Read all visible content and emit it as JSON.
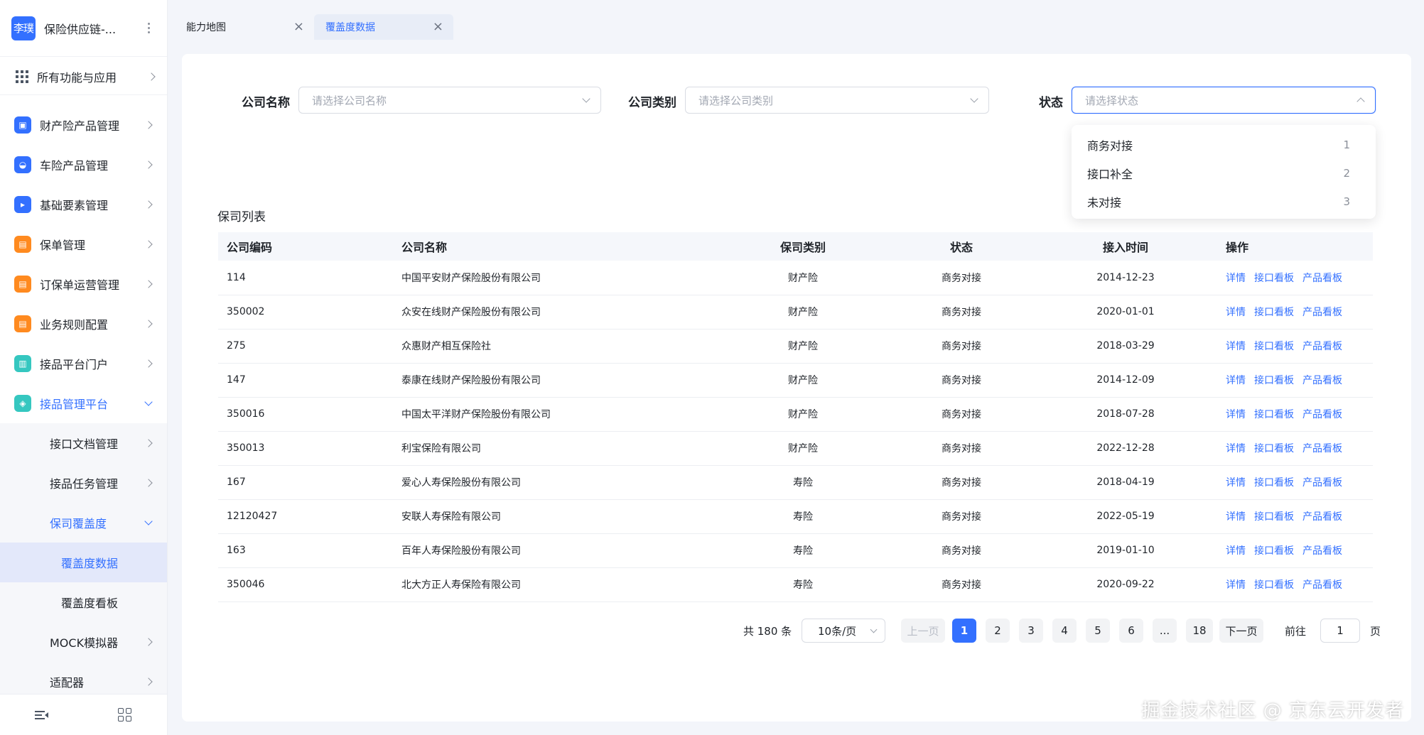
{
  "sidebar": {
    "avatar_text": "李璞",
    "app_title": "保险供应链-...",
    "all_apps_label": "所有功能与应用",
    "items": [
      {
        "label": "财产险产品管理",
        "icon": "briefcase-icon",
        "color": "#3370ff"
      },
      {
        "label": "车险产品管理",
        "icon": "car-icon",
        "color": "#3370ff"
      },
      {
        "label": "基础要素管理",
        "icon": "terminal-icon",
        "color": "#3370ff"
      },
      {
        "label": "保单管理",
        "icon": "document-icon",
        "color": "#ff8a1f"
      },
      {
        "label": "订保单运营管理",
        "icon": "document-icon",
        "color": "#ff8a1f"
      },
      {
        "label": "业务规则配置",
        "icon": "document-icon",
        "color": "#ff8a1f"
      },
      {
        "label": "接品平台门户",
        "icon": "notebook-icon",
        "color": "#35c7c0"
      },
      {
        "label": "接品管理平台",
        "icon": "cube-icon",
        "color": "#35c7c0"
      }
    ],
    "sub_items": [
      {
        "label": "接口文档管理"
      },
      {
        "label": "接品任务管理"
      },
      {
        "label": "保司覆盖度"
      },
      {
        "label": "覆盖度数据"
      },
      {
        "label": "覆盖度看板"
      },
      {
        "label": "MOCK模拟器"
      },
      {
        "label": "适配器"
      }
    ]
  },
  "tabs": [
    {
      "label": "能力地图",
      "close": "×"
    },
    {
      "label": "覆盖度数据",
      "close": "×"
    }
  ],
  "filters": {
    "company_name": {
      "label": "公司名称",
      "placeholder": "请选择公司名称"
    },
    "company_type": {
      "label": "公司类别",
      "placeholder": "请选择公司类别"
    },
    "status": {
      "label": "状态",
      "placeholder": "请选择状态"
    }
  },
  "status_options": [
    {
      "label": "商务对接",
      "value": "1"
    },
    {
      "label": "接口补全",
      "value": "2"
    },
    {
      "label": "未对接",
      "value": "3"
    }
  ],
  "list": {
    "title": "保司列表",
    "columns": [
      "公司编码",
      "公司名称",
      "保司类别",
      "状态",
      "接入时间",
      "操作"
    ],
    "actions": [
      "详情",
      "接口看板",
      "产品看板"
    ],
    "rows": [
      {
        "code": "114",
        "name": "中国平安财产保险股份有限公司",
        "type": "财产险",
        "status": "商务对接",
        "date": "2014-12-23"
      },
      {
        "code": "350002",
        "name": "众安在线财产保险股份有限公司",
        "type": "财产险",
        "status": "商务对接",
        "date": "2020-01-01"
      },
      {
        "code": "275",
        "name": "众惠财产相互保险社",
        "type": "财产险",
        "status": "商务对接",
        "date": "2018-03-29"
      },
      {
        "code": "147",
        "name": "泰康在线财产保险股份有限公司",
        "type": "财产险",
        "status": "商务对接",
        "date": "2014-12-09"
      },
      {
        "code": "350016",
        "name": "中国太平洋财产保险股份有限公司",
        "type": "财产险",
        "status": "商务对接",
        "date": "2018-07-28"
      },
      {
        "code": "350013",
        "name": "利宝保险有限公司",
        "type": "财产险",
        "status": "商务对接",
        "date": "2022-12-28"
      },
      {
        "code": "167",
        "name": "爱心人寿保险股份有限公司",
        "type": "寿险",
        "status": "商务对接",
        "date": "2018-04-19"
      },
      {
        "code": "12120427",
        "name": "安联人寿保险有限公司",
        "type": "寿险",
        "status": "商务对接",
        "date": "2022-05-19"
      },
      {
        "code": "163",
        "name": "百年人寿保险股份有限公司",
        "type": "寿险",
        "status": "商务对接",
        "date": "2019-01-10"
      },
      {
        "code": "350046",
        "name": "北大方正人寿保险有限公司",
        "type": "寿险",
        "status": "商务对接",
        "date": "2020-09-22"
      }
    ]
  },
  "pagination": {
    "total": "共 180 条",
    "page_size": "10条/页",
    "prev": "上一页",
    "pages": [
      "1",
      "2",
      "3",
      "4",
      "5",
      "6",
      "...",
      "18"
    ],
    "current": "1",
    "next": "下一页",
    "goto_label": "前往",
    "goto_value": "1",
    "page_suffix": "页"
  },
  "watermark": "掘金技术社区 @ 京东云开发者",
  "colors": {
    "accent": "#3370ff",
    "orange": "#ff8a1f",
    "teal": "#35c7c0"
  }
}
